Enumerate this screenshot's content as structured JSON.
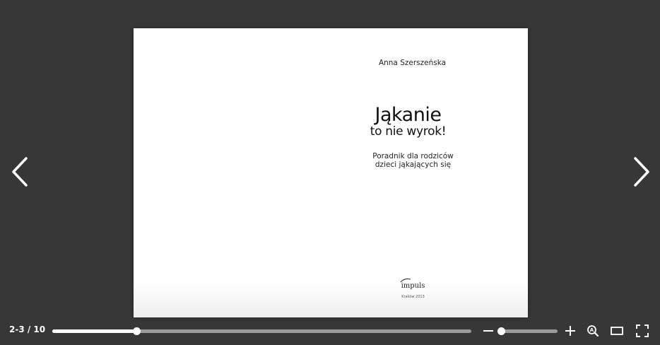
{
  "book": {
    "author": "Anna Szerszeńska",
    "title": "Jąkanie",
    "subtitle": "to nie wyrok!",
    "tagline_line1": "Poradnik dla rodziców",
    "tagline_line2": "dzieci jąkających się",
    "publisher": "impuls",
    "publisher_place": "Kraków 2013"
  },
  "toolbar": {
    "page_counter": "2-3 / 10",
    "progress_fraction": 0.2,
    "zoom_fraction": 0.05
  },
  "icons": {
    "prev": "chevron-left-icon",
    "next": "chevron-right-icon",
    "zoom_out": "minus-icon",
    "zoom_in": "plus-icon",
    "auto_zoom": "magnifier-a-icon",
    "fit_width": "rectangle-icon",
    "fullscreen": "fullscreen-icon"
  },
  "colors": {
    "background": "#373737",
    "page": "#ffffff",
    "controls": "#ffffff",
    "track": "#9a9a9a"
  }
}
